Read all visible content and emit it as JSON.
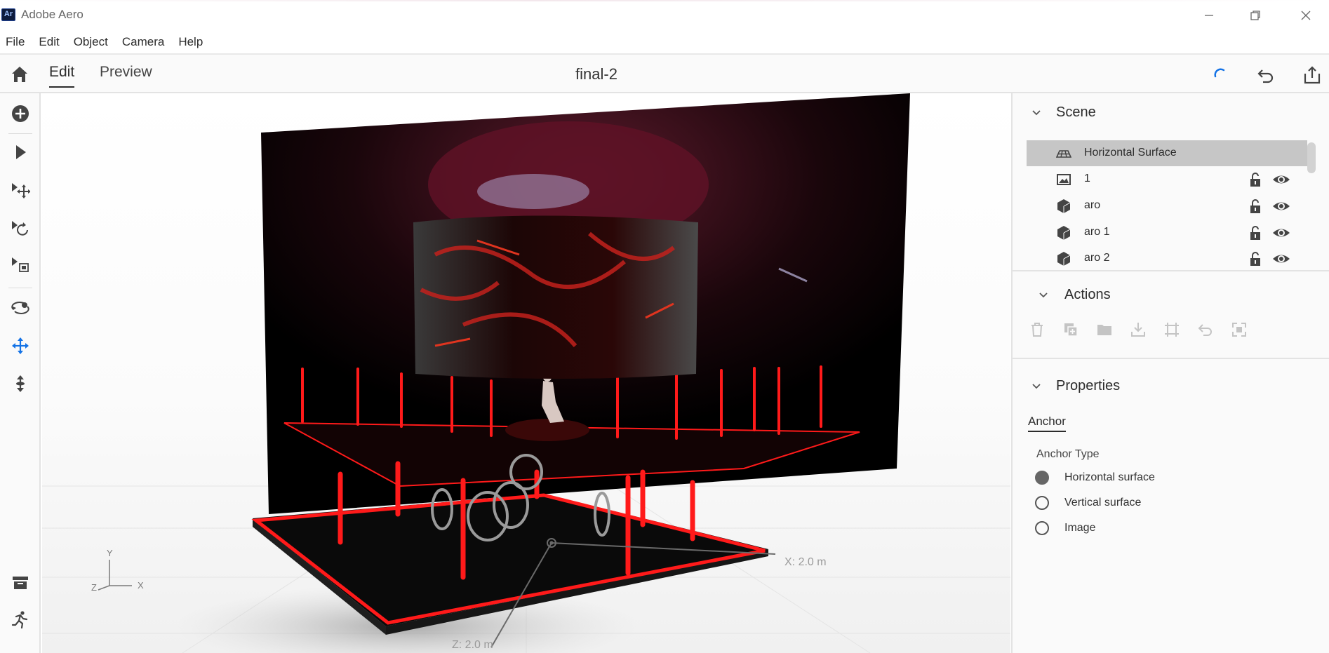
{
  "window": {
    "app_logo": "Ar",
    "title": "Adobe Aero",
    "minimize_icon": "minimize-icon",
    "restore_icon": "restore-icon",
    "close_icon": "close-icon"
  },
  "menu": [
    "File",
    "Edit",
    "Object",
    "Camera",
    "Help"
  ],
  "toolbar": {
    "tabs": [
      "Edit",
      "Preview"
    ],
    "active_tab": "Edit",
    "document_title": "final-2",
    "icons": [
      "home-icon",
      "loading-spinner-icon",
      "undo-icon",
      "share-icon"
    ]
  },
  "tools": [
    "add-icon",
    "select-icon",
    "move-icon",
    "rotate-icon",
    "scale-icon",
    "orbit-icon",
    "pan-icon",
    "dolly-icon",
    "archive-icon",
    "behavior-run-icon"
  ],
  "viewport": {
    "axis_labels": {
      "y": "Y",
      "x": "X",
      "z": "Z"
    },
    "dimension_x": "X: 2.0 m",
    "dimension_z": "Z: 2.0 m",
    "accent_red": "#ff1a1a"
  },
  "scene": {
    "title": "Scene",
    "layers": [
      {
        "name": "Horizontal Surface",
        "icon": "surface-grid-icon",
        "selected": true
      },
      {
        "name": "1",
        "icon": "image-icon",
        "selected": false
      },
      {
        "name": "aro",
        "icon": "cube-icon",
        "selected": false
      },
      {
        "name": "aro 1",
        "icon": "cube-icon",
        "selected": false
      },
      {
        "name": "aro 2",
        "icon": "cube-icon",
        "selected": false
      }
    ]
  },
  "actions": {
    "title": "Actions",
    "icons": [
      "delete-icon",
      "duplicate-icon",
      "group-icon",
      "import-icon",
      "fit-icon",
      "reset-icon",
      "ungroup-icon"
    ]
  },
  "properties": {
    "title": "Properties",
    "tab": "Anchor",
    "anchor_type_label": "Anchor Type",
    "options": [
      "Horizontal surface",
      "Vertical surface",
      "Image"
    ],
    "selected_option": "Horizontal surface"
  }
}
